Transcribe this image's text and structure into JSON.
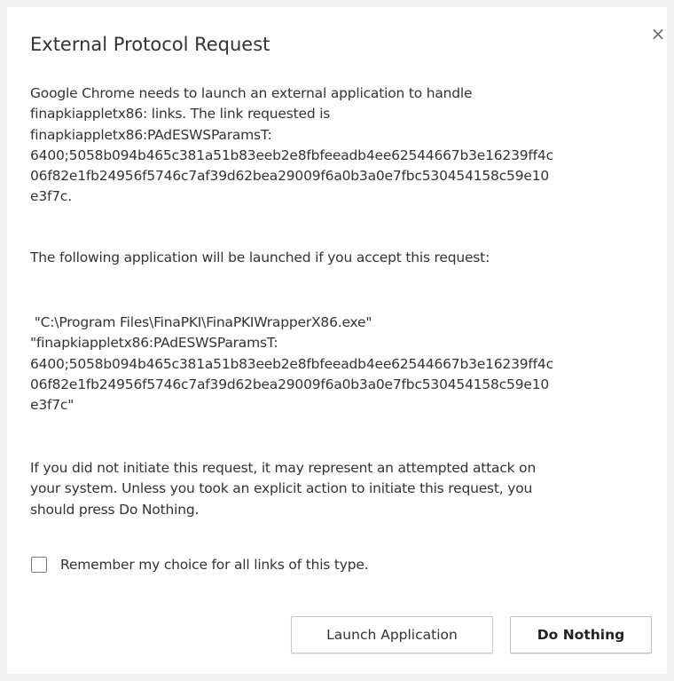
{
  "dialog": {
    "title": "External Protocol Request",
    "close_glyph": "×",
    "close_icon": "close-icon",
    "description_lines": [
      "Google Chrome needs to launch an external application to handle",
      "finapkiappletx86: links. The link requested is",
      "finapkiappletx86:PAdESWSParamsT:",
      "6400;5058b094b465c381a51b83eeb2e8fbfeeadb4ee62544667b3e16239ff4c",
      "06f82e1fb24956f5746c7af39d62bea29009f6a0b3a0e7fbc530454158c59e10",
      "e3f7c."
    ],
    "following_text": "The following application will be launched if you accept this request:",
    "application_lines": [
      " \"C:\\Program Files\\FinaPKI\\FinaPKIWrapperX86.exe\"",
      "\"finapkiappletx86:PAdESWSParamsT:",
      "6400;5058b094b465c381a51b83eeb2e8fbfeeadb4ee62544667b3e16239ff4c",
      "06f82e1fb24956f5746c7af39d62bea29009f6a0b3a0e7fbc530454158c59e10",
      "e3f7c\""
    ],
    "warning_lines": [
      "If you did not initiate this request, it may represent an attempted attack on",
      "your system. Unless you took an explicit action to initiate this request, you",
      "should press Do Nothing."
    ],
    "remember_label": "Remember my choice for all links of this type.",
    "remember_checked": false,
    "launch_button": "Launch Application",
    "do_nothing_button": "Do Nothing"
  }
}
